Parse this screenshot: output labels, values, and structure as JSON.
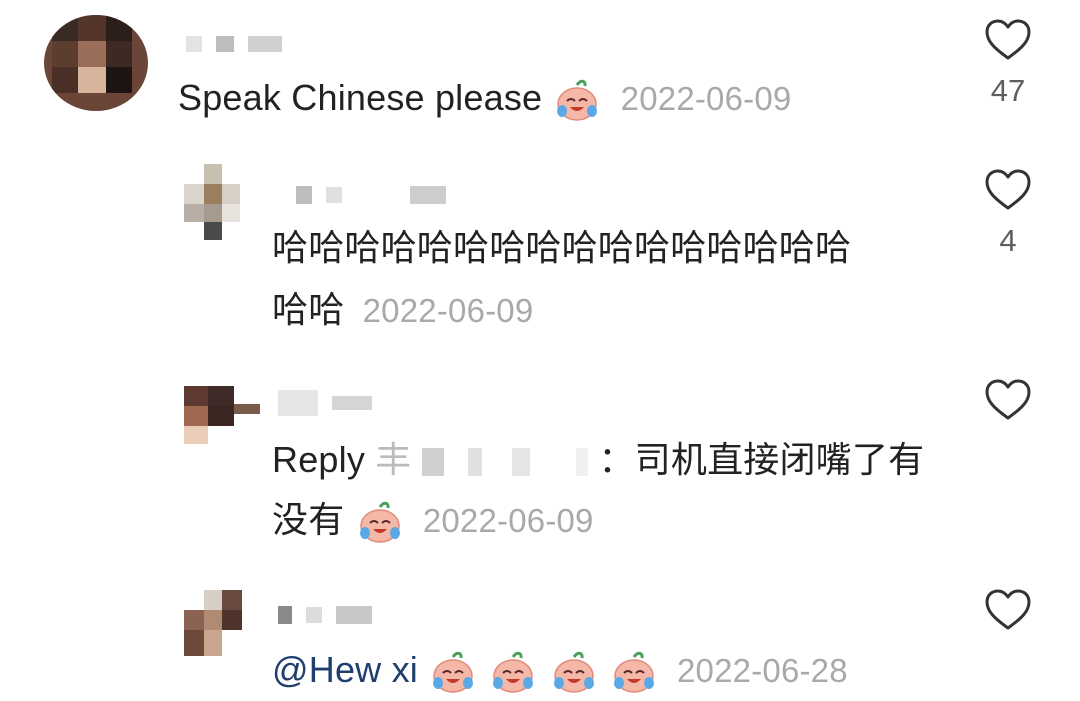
{
  "comments": [
    {
      "text": "Speak Chinese please",
      "date": "2022-06-09",
      "likes": "47",
      "has_emoji": true
    },
    {
      "text_line1": "哈哈哈哈哈哈哈哈哈哈哈哈哈哈哈哈",
      "text_line2": "哈哈",
      "date": "2022-06-09",
      "likes": "4"
    },
    {
      "reply_prefix": "Reply",
      "reply_char": "丰",
      "text_line1": "：司机直接闭嘴了有",
      "text_line2": "没有",
      "date": "2022-06-09",
      "likes": ""
    },
    {
      "mention": "@Hew xi",
      "date": "2022-06-28",
      "likes": ""
    }
  ],
  "icons": {
    "like": "heart-outline-icon",
    "emoji": "crying-laughing-peach-emoji"
  },
  "colors": {
    "date": "#a9a9a9",
    "mention": "#1f3f6e",
    "heart_stroke": "#333333"
  }
}
